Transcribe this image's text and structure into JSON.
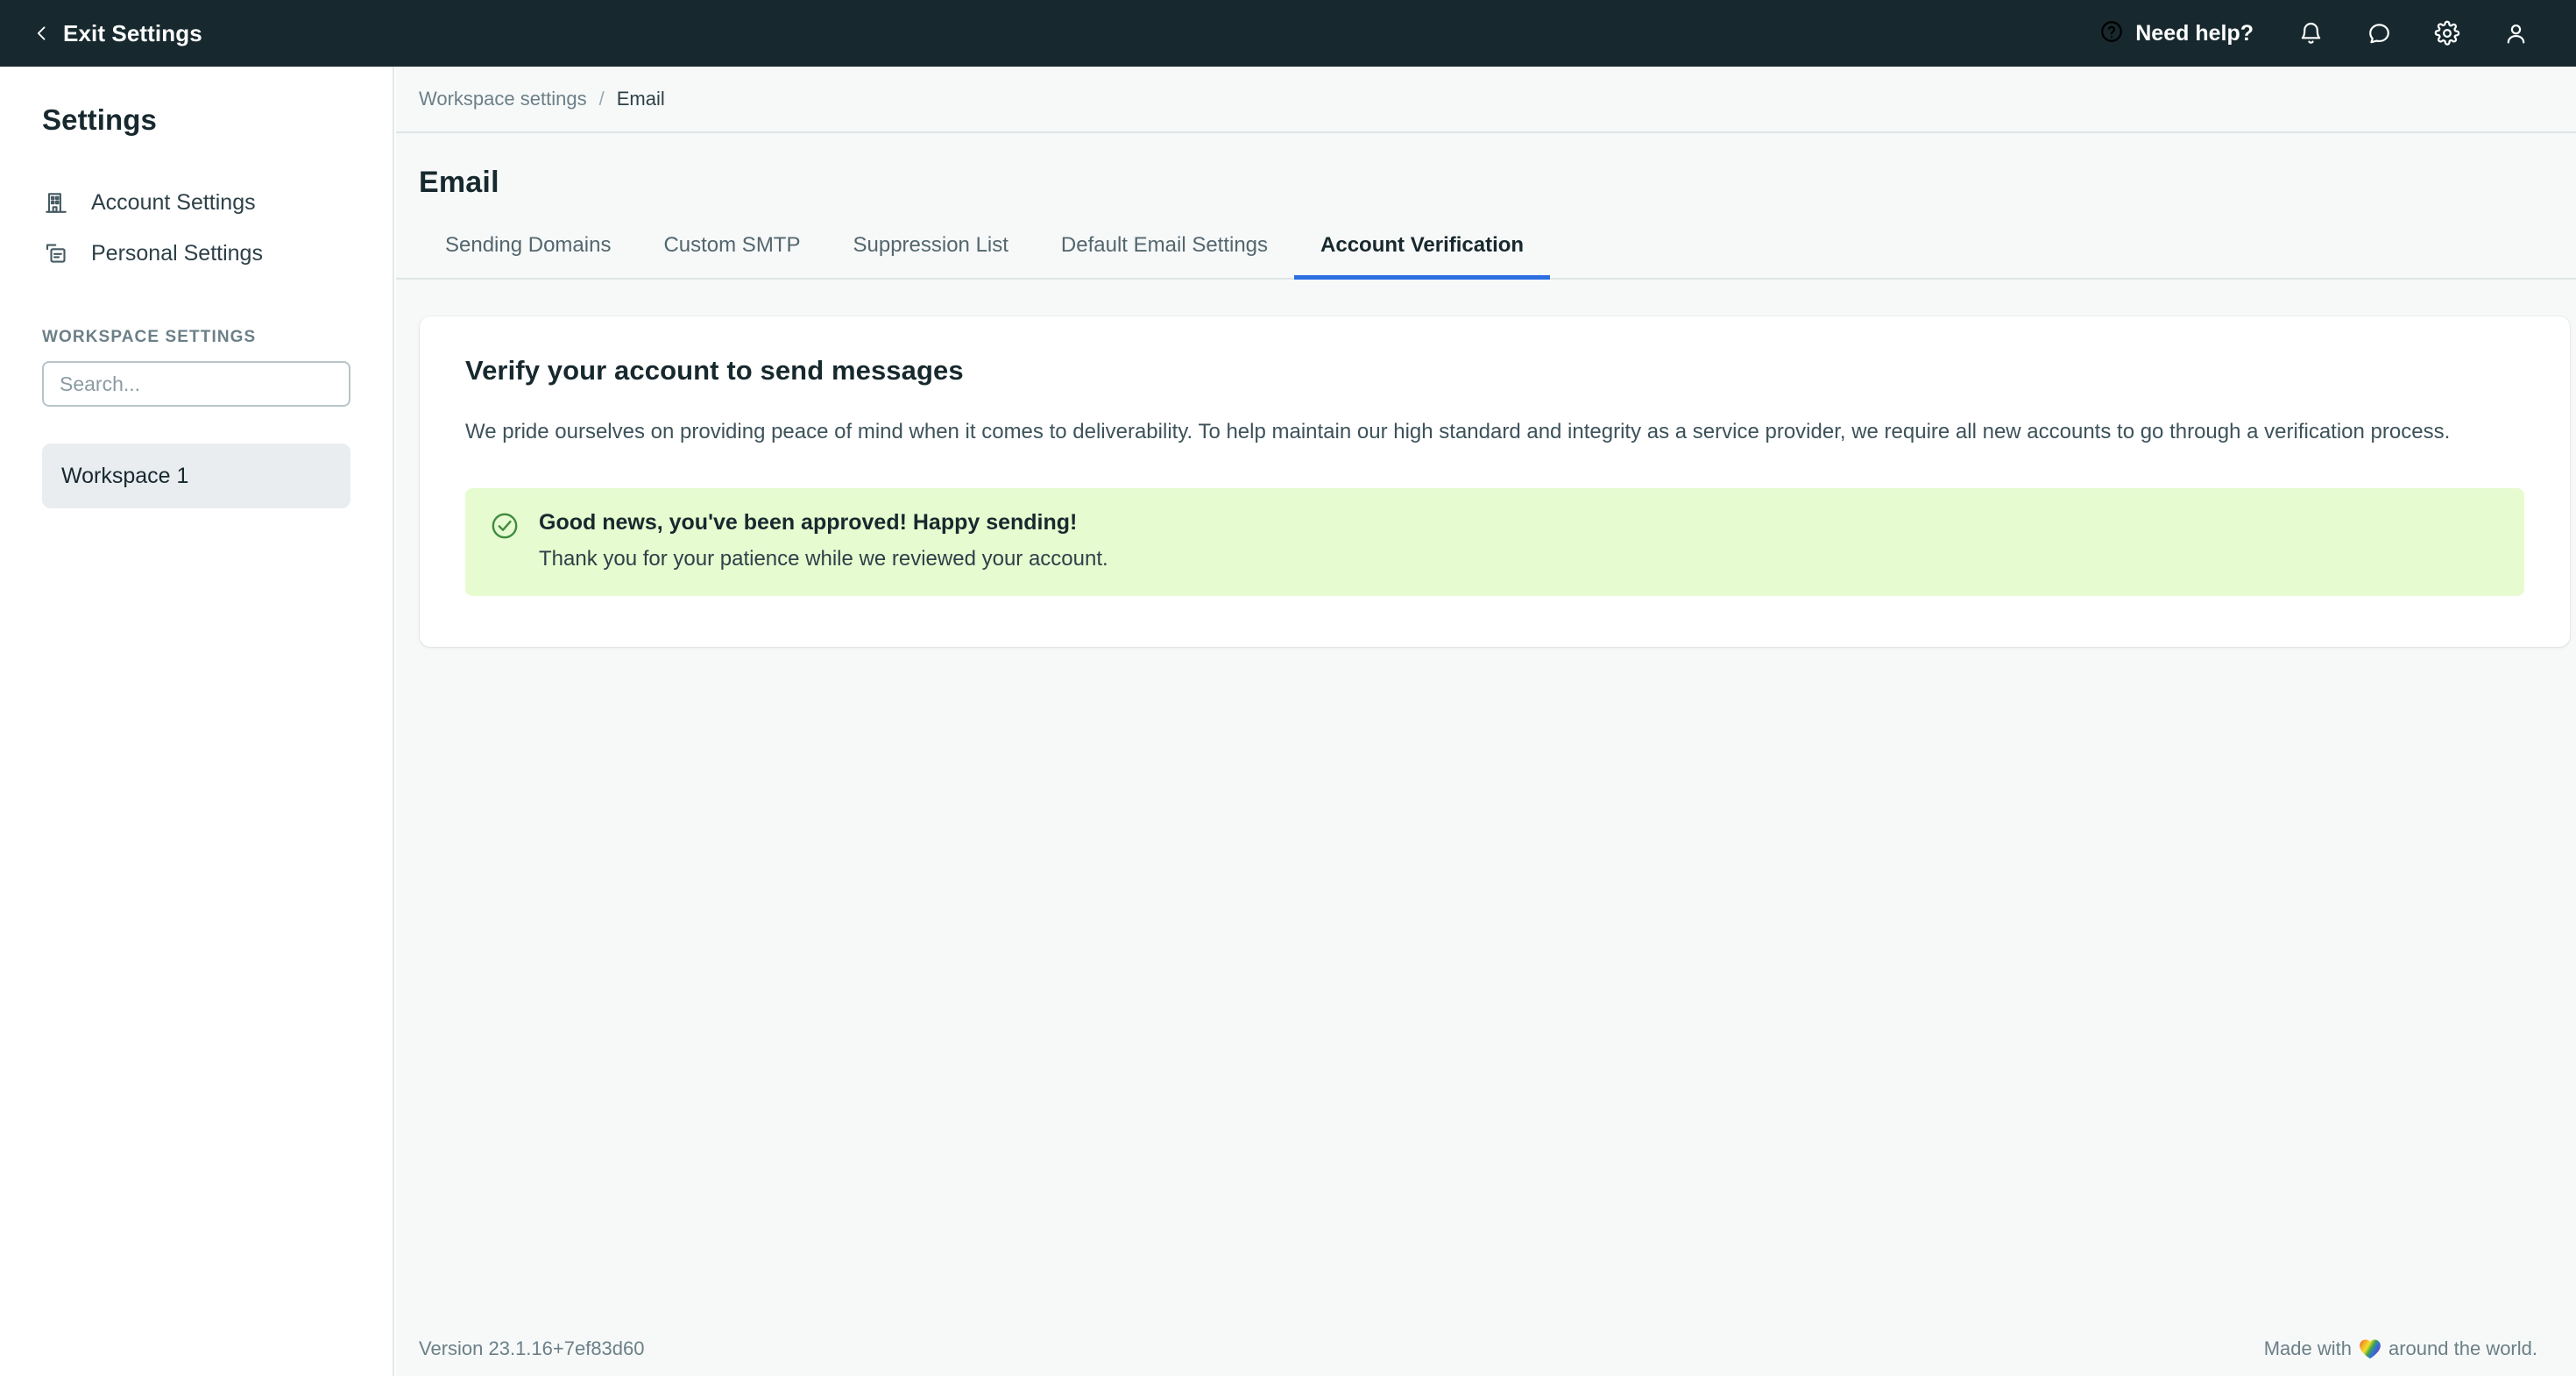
{
  "topbar": {
    "exit_label": "Exit Settings",
    "back_icon": "chevron-left-icon",
    "need_help_label": "Need help?",
    "icons": [
      "help-circle-icon",
      "bell-icon",
      "chat-bubble-icon",
      "gear-icon",
      "user-icon"
    ],
    "background_color": "#17292e"
  },
  "sidebar": {
    "title": "Settings",
    "items": [
      {
        "label": "Account Settings",
        "icon": "building-icon"
      },
      {
        "label": "Personal Settings",
        "icon": "card-duplicate-icon"
      }
    ],
    "section_label": "WORKSPACE SETTINGS",
    "search": {
      "value": "",
      "placeholder": "Search..."
    },
    "workspaces": [
      {
        "label": "Workspace 1",
        "selected": true
      }
    ]
  },
  "breadcrumb": {
    "parent": "Workspace settings",
    "separator": "/",
    "current": "Email"
  },
  "main": {
    "page_title": "Email",
    "tabs": [
      {
        "label": "Sending Domains",
        "active": false
      },
      {
        "label": "Custom SMTP",
        "active": false
      },
      {
        "label": "Suppression List",
        "active": false
      },
      {
        "label": "Default Email Settings",
        "active": false
      },
      {
        "label": "Account Verification",
        "active": true
      }
    ],
    "active_tab_color": "#2d6fe0",
    "card": {
      "title": "Verify your account to send messages",
      "paragraph": "We pride ourselves on providing peace of mind when it comes to deliverability. To help maintain our high standard and integrity as a service provider, we require all new accounts to go through a verification process.",
      "alert": {
        "icon": "check-circle-icon",
        "title": "Good news, you've been approved! Happy sending!",
        "subtitle": "Thank you for your patience while we reviewed your account.",
        "background_color": "#e6fbd0",
        "icon_color": "#3f8b3f"
      }
    }
  },
  "footer": {
    "version": "Version 23.1.16+7ef83d60",
    "made_with_prefix": "Made with",
    "made_with_icon": "rainbow-heart-icon",
    "made_with_suffix": "around the world."
  }
}
